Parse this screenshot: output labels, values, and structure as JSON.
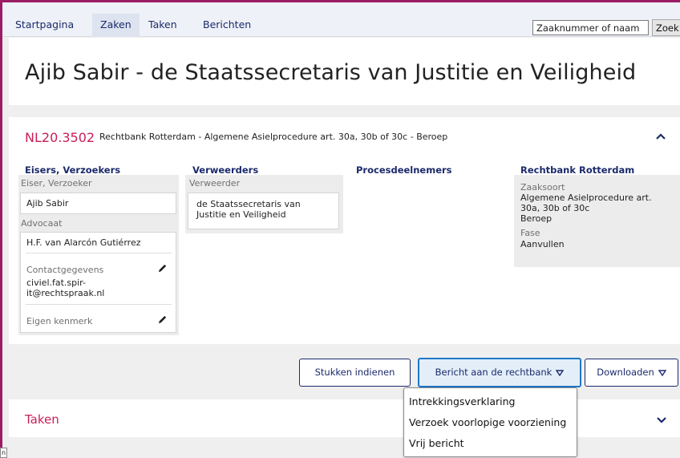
{
  "nav": {
    "tabs": [
      {
        "label": "Startpagina"
      },
      {
        "label": "Zaken",
        "active": true
      },
      {
        "label": "Taken"
      },
      {
        "label": "Berichten"
      }
    ],
    "search_placeholder": "Zaaknummer of naam",
    "search_button": "Zoek"
  },
  "page": {
    "title": "Ajib Sabir - de Staatssecretaris van Justitie en Veiligheid"
  },
  "case": {
    "number": "NL20.3502",
    "description": "Rechtbank Rotterdam - Algemene Asielprocedure art. 30a, 30b of 30c - Beroep",
    "chevron_icon": "chevron-up-icon",
    "columns": {
      "eisers": {
        "heading": "Eisers, Verzoekers",
        "eiser_label": "Eiser, Verzoeker",
        "eiser_name": "Ajib Sabir",
        "advocaat_label": "Advocaat",
        "advocaat_name": "H.F. van Alarcón Gutiérrez",
        "contact_label": "Contactgegevens",
        "contact_line1": "civiel.fat.spir-",
        "contact_line2": "it@rechtspraak.nl",
        "kenmerk_label": "Eigen kenmerk",
        "edit_icon": "pencil-icon"
      },
      "verweerders": {
        "heading": "Verweerders",
        "label": "Verweerder",
        "name_line1": "de Staatssecretaris van",
        "name_line2": "Justitie en Veiligheid"
      },
      "procesdeelnemers": {
        "heading": "Procesdeelnemers"
      },
      "rechtbank": {
        "heading": "Rechtbank Rotterdam",
        "zaaksoort_label": "Zaaksoort",
        "zaaksoort_line1": "Algemene Asielprocedure art.",
        "zaaksoort_line2": "30a, 30b of 30c",
        "zaaksoort_line3": "Beroep",
        "fase_label": "Fase",
        "fase_value": "Aanvullen"
      }
    }
  },
  "actions": {
    "stukken": "Stukken indienen",
    "bericht": "Bericht aan de rechtbank",
    "downloaden": "Downloaden",
    "dropdown_icon": "triangle-down-icon"
  },
  "dropdown": {
    "items": [
      "Intrekkingsverklaring",
      "Verzoek voorlopige voorziening",
      "Vrij bericht"
    ]
  },
  "taken": {
    "title": "Taken",
    "chevron_icon": "chevron-down-icon"
  },
  "corner": {
    "text": "n"
  },
  "colors": {
    "accent": "#c81e5a",
    "navy": "#1b2a6b",
    "frame": "#9b1c64",
    "highlight_border": "#1e77c9"
  }
}
